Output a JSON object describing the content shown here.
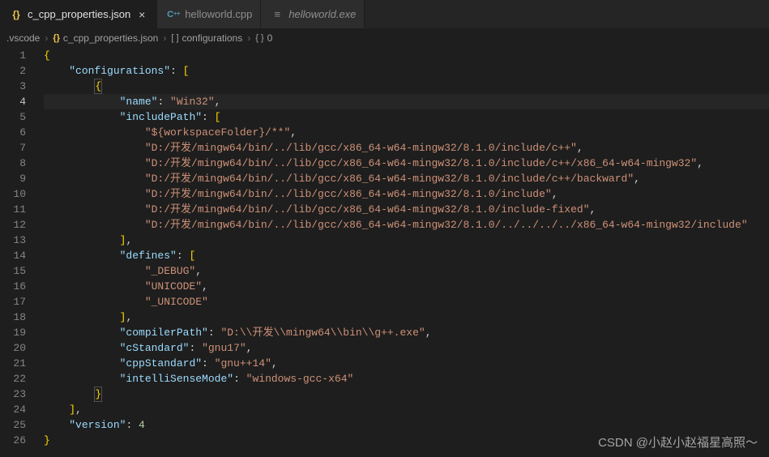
{
  "tabs": [
    {
      "label": "c_cpp_properties.json",
      "icon": "braces",
      "active": true,
      "closeable": true
    },
    {
      "label": "helloworld.cpp",
      "icon": "cpp",
      "active": false,
      "closeable": false
    },
    {
      "label": "helloworld.exe",
      "icon": "exe",
      "active": false,
      "closeable": false,
      "italic": true
    }
  ],
  "breadcrumb": {
    "items": [
      {
        "text": ".vscode"
      },
      {
        "icon": "{}",
        "text": "c_cpp_properties.json"
      },
      {
        "icon": "[ ]",
        "text": "configurations"
      },
      {
        "icon": "{ }",
        "text": "0"
      }
    ]
  },
  "currentLine": 4,
  "code": {
    "lines": [
      {
        "n": 1,
        "tokens": [
          {
            "c": "p-brace",
            "t": "{"
          }
        ]
      },
      {
        "n": 2,
        "tokens": [
          {
            "t": "    "
          },
          {
            "c": "p-key",
            "t": "\"configurations\""
          },
          {
            "c": "p-punct",
            "t": ": "
          },
          {
            "c": "p-brace",
            "t": "["
          }
        ]
      },
      {
        "n": 3,
        "tokens": [
          {
            "t": "        "
          },
          {
            "c": "p-brace highlight-box",
            "t": "{"
          }
        ]
      },
      {
        "n": 4,
        "tokens": [
          {
            "t": "            "
          },
          {
            "c": "p-key",
            "t": "\"name\""
          },
          {
            "c": "p-punct",
            "t": ": "
          },
          {
            "c": "p-str",
            "t": "\"Win32\""
          },
          {
            "c": "p-punct",
            "t": ","
          }
        ]
      },
      {
        "n": 5,
        "tokens": [
          {
            "t": "            "
          },
          {
            "c": "p-key",
            "t": "\"includePath\""
          },
          {
            "c": "p-punct",
            "t": ": "
          },
          {
            "c": "p-brace",
            "t": "["
          }
        ]
      },
      {
        "n": 6,
        "tokens": [
          {
            "t": "                "
          },
          {
            "c": "p-str",
            "t": "\"${workspaceFolder}/**\""
          },
          {
            "c": "p-punct",
            "t": ","
          }
        ]
      },
      {
        "n": 7,
        "tokens": [
          {
            "t": "                "
          },
          {
            "c": "p-str",
            "t": "\"D:/开发/mingw64/bin/../lib/gcc/x86_64-w64-mingw32/8.1.0/include/c++\""
          },
          {
            "c": "p-punct",
            "t": ","
          }
        ]
      },
      {
        "n": 8,
        "tokens": [
          {
            "t": "                "
          },
          {
            "c": "p-str",
            "t": "\"D:/开发/mingw64/bin/../lib/gcc/x86_64-w64-mingw32/8.1.0/include/c++/x86_64-w64-mingw32\""
          },
          {
            "c": "p-punct",
            "t": ","
          }
        ]
      },
      {
        "n": 9,
        "tokens": [
          {
            "t": "                "
          },
          {
            "c": "p-str",
            "t": "\"D:/开发/mingw64/bin/../lib/gcc/x86_64-w64-mingw32/8.1.0/include/c++/backward\""
          },
          {
            "c": "p-punct",
            "t": ","
          }
        ]
      },
      {
        "n": 10,
        "tokens": [
          {
            "t": "                "
          },
          {
            "c": "p-str",
            "t": "\"D:/开发/mingw64/bin/../lib/gcc/x86_64-w64-mingw32/8.1.0/include\""
          },
          {
            "c": "p-punct",
            "t": ","
          }
        ]
      },
      {
        "n": 11,
        "tokens": [
          {
            "t": "                "
          },
          {
            "c": "p-str",
            "t": "\"D:/开发/mingw64/bin/../lib/gcc/x86_64-w64-mingw32/8.1.0/include-fixed\""
          },
          {
            "c": "p-punct",
            "t": ","
          }
        ]
      },
      {
        "n": 12,
        "tokens": [
          {
            "t": "                "
          },
          {
            "c": "p-str",
            "t": "\"D:/开发/mingw64/bin/../lib/gcc/x86_64-w64-mingw32/8.1.0/../../../../x86_64-w64-mingw32/include\""
          }
        ]
      },
      {
        "n": 13,
        "tokens": [
          {
            "t": "            "
          },
          {
            "c": "p-brace",
            "t": "]"
          },
          {
            "c": "p-punct",
            "t": ","
          }
        ]
      },
      {
        "n": 14,
        "tokens": [
          {
            "t": "            "
          },
          {
            "c": "p-key",
            "t": "\"defines\""
          },
          {
            "c": "p-punct",
            "t": ": "
          },
          {
            "c": "p-brace",
            "t": "["
          }
        ]
      },
      {
        "n": 15,
        "tokens": [
          {
            "t": "                "
          },
          {
            "c": "p-str",
            "t": "\"_DEBUG\""
          },
          {
            "c": "p-punct",
            "t": ","
          }
        ]
      },
      {
        "n": 16,
        "tokens": [
          {
            "t": "                "
          },
          {
            "c": "p-str",
            "t": "\"UNICODE\""
          },
          {
            "c": "p-punct",
            "t": ","
          }
        ]
      },
      {
        "n": 17,
        "tokens": [
          {
            "t": "                "
          },
          {
            "c": "p-str",
            "t": "\"_UNICODE\""
          }
        ]
      },
      {
        "n": 18,
        "tokens": [
          {
            "t": "            "
          },
          {
            "c": "p-brace",
            "t": "]"
          },
          {
            "c": "p-punct",
            "t": ","
          }
        ]
      },
      {
        "n": 19,
        "tokens": [
          {
            "t": "            "
          },
          {
            "c": "p-key",
            "t": "\"compilerPath\""
          },
          {
            "c": "p-punct",
            "t": ": "
          },
          {
            "c": "p-str",
            "t": "\"D:\\\\开发\\\\mingw64\\\\bin\\\\g++.exe\""
          },
          {
            "c": "p-punct",
            "t": ","
          }
        ]
      },
      {
        "n": 20,
        "tokens": [
          {
            "t": "            "
          },
          {
            "c": "p-key",
            "t": "\"cStandard\""
          },
          {
            "c": "p-punct",
            "t": ": "
          },
          {
            "c": "p-str",
            "t": "\"gnu17\""
          },
          {
            "c": "p-punct",
            "t": ","
          }
        ]
      },
      {
        "n": 21,
        "tokens": [
          {
            "t": "            "
          },
          {
            "c": "p-key",
            "t": "\"cppStandard\""
          },
          {
            "c": "p-punct",
            "t": ": "
          },
          {
            "c": "p-str",
            "t": "\"gnu++14\""
          },
          {
            "c": "p-punct",
            "t": ","
          }
        ]
      },
      {
        "n": 22,
        "tokens": [
          {
            "t": "            "
          },
          {
            "c": "p-key",
            "t": "\"intelliSenseMode\""
          },
          {
            "c": "p-punct",
            "t": ": "
          },
          {
            "c": "p-str",
            "t": "\"windows-gcc-x64\""
          }
        ]
      },
      {
        "n": 23,
        "tokens": [
          {
            "t": "        "
          },
          {
            "c": "p-brace highlight-box",
            "t": "}"
          }
        ]
      },
      {
        "n": 24,
        "tokens": [
          {
            "t": "    "
          },
          {
            "c": "p-brace",
            "t": "]"
          },
          {
            "c": "p-punct",
            "t": ","
          }
        ]
      },
      {
        "n": 25,
        "tokens": [
          {
            "t": "    "
          },
          {
            "c": "p-key",
            "t": "\"version\""
          },
          {
            "c": "p-punct",
            "t": ": "
          },
          {
            "c": "p-num",
            "t": "4"
          }
        ]
      },
      {
        "n": 26,
        "tokens": [
          {
            "c": "p-brace",
            "t": "}"
          }
        ]
      }
    ]
  },
  "watermark": "CSDN @小赵小赵福星高照～"
}
